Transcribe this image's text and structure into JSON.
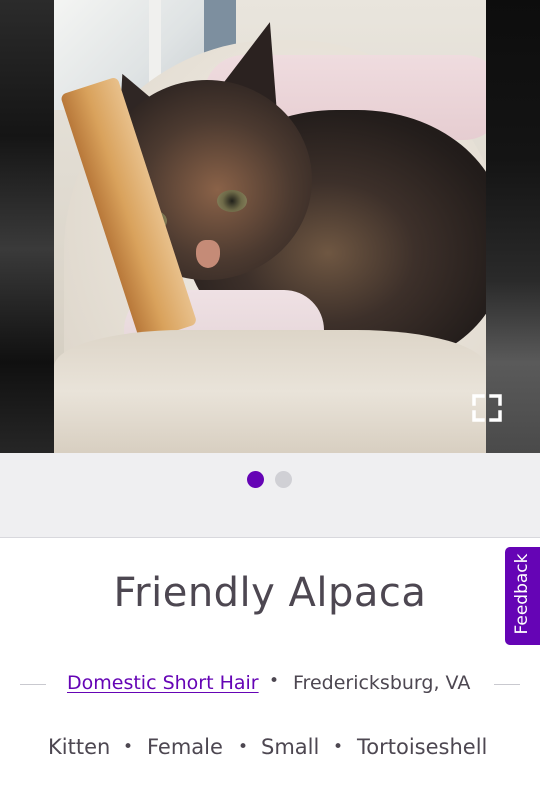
{
  "carousel": {
    "expand_icon": "expand-fullscreen-icon",
    "slide_count": 2,
    "active_slide": 1
  },
  "pet": {
    "name": "Friendly Alpaca",
    "breed": "Domestic Short Hair",
    "location": "Fredericksburg, VA",
    "separator": "•",
    "traits": [
      "Kitten",
      "Female",
      "Small",
      "Tortoiseshell"
    ]
  },
  "feedback": {
    "label": "Feedback"
  },
  "colors": {
    "accent": "#6504b5",
    "text": "#4d4751",
    "dot_inactive": "#d0d0d5",
    "band": "#efeff1"
  }
}
